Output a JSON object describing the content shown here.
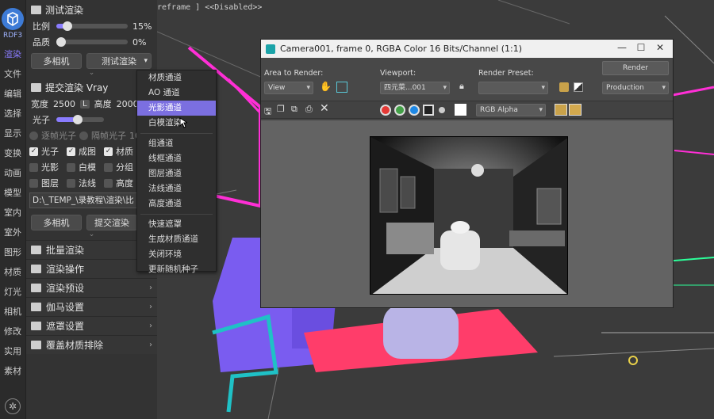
{
  "viewport": {
    "label": "reframe ] <<Disabled>>"
  },
  "rail": {
    "logo_text": "RDF3",
    "items": [
      "渲染",
      "文件",
      "编辑",
      "选择",
      "显示",
      "变换",
      "动画",
      "模型",
      "室内",
      "室外",
      "图形",
      "材质",
      "灯光",
      "相机",
      "修改",
      "实用",
      "素材"
    ]
  },
  "panel": {
    "test_render": {
      "title": "测试渲染",
      "ratio_label": "比例",
      "ratio_value": "15%",
      "ratio_level": 0.15,
      "quality_label": "品质",
      "quality_value": "0%",
      "quality_level": 0.0,
      "multicam_btn": "多相机",
      "test_btn": "测试渲染"
    },
    "submit_render": {
      "title": "提交渲染 Vray",
      "width_label": "宽度",
      "width_value": "2500",
      "lock_label": "L",
      "height_label": "高度",
      "height_value": "2000",
      "photon_label": "光子",
      "photon_level": 0.45,
      "radio_a": "逐帧光子",
      "radio_b": "隔帧光子",
      "radio_value": "10",
      "checks_row1": [
        {
          "label": "光子",
          "on": true
        },
        {
          "label": "成图",
          "on": true
        },
        {
          "label": "材质",
          "on": true
        }
      ],
      "checks_row2": [
        {
          "label": "光影",
          "on": false
        },
        {
          "label": "白模",
          "on": false
        },
        {
          "label": "分组",
          "on": false
        }
      ],
      "checks_row3": [
        {
          "label": "图层",
          "on": false
        },
        {
          "label": "法线",
          "on": false
        },
        {
          "label": "高度",
          "on": false
        }
      ],
      "path": "D:\\_TEMP_\\录教程\\渲染\\比",
      "multicam_btn": "多相机",
      "submit_btn": "提交渲染"
    },
    "accordions": [
      "批量渲染",
      "渲染操作",
      "渲染预设",
      "伽马设置",
      "遮罩设置",
      "覆盖材质排除"
    ]
  },
  "menu": {
    "items": [
      "材质通道",
      "AO 通道",
      "光影通道",
      "白模渲染",
      "组通道",
      "线框通道",
      "图层通道",
      "法线通道",
      "高度通道",
      "快速遮罩",
      "生成材质通道",
      "关闭环境",
      "更新随机种子"
    ],
    "highlighted": "光影通道"
  },
  "render_window": {
    "title": "Camera001, frame 0, RGBA Color 16 Bits/Channel (1:1)",
    "area_label": "Area to Render:",
    "area_value": "View",
    "viewport_label": "Viewport:",
    "viewport_value": "四元菜...001",
    "preset_label": "Render Preset:",
    "preset_value": "",
    "render_btn": "Render",
    "production_value": "Production",
    "channel_value": "RGB Alpha",
    "colors": {
      "red": "#e53935",
      "green": "#43a047",
      "blue": "#1e88e5",
      "accent": "#7b6fe0"
    }
  }
}
